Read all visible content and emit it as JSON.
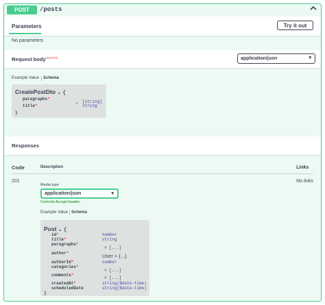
{
  "operation": {
    "method": "POST",
    "path": "/posts"
  },
  "parameters": {
    "tab": "Parameters",
    "try_button": "Try it out",
    "empty": "No parameters"
  },
  "request_body": {
    "title": "Request body",
    "required": "required",
    "content_type": "application/json",
    "tab_example": "Example Value",
    "tab_schema": "Schema",
    "model": {
      "name": "CreatePostDto",
      "open": "{",
      "close": "}",
      "props": [
        {
          "name": "paragraphs",
          "type": "[string]",
          "expand": "⌄"
        },
        {
          "name": "title",
          "type": "string"
        }
      ]
    }
  },
  "responses": {
    "title": "Responses",
    "col_code": "Code",
    "col_desc": "Description",
    "col_links": "Links",
    "row": {
      "code": "201",
      "links": "No links",
      "media_type_label": "Media type",
      "media_type": "application/json",
      "controls": "Controls Accept header.",
      "tab_example": "Example Value",
      "tab_schema": "Schema",
      "model": {
        "name": "Post",
        "open": "{",
        "close": "}",
        "props": [
          {
            "name": "id",
            "type": "number"
          },
          {
            "name": "title",
            "type": "string"
          },
          {
            "name": "paragraphs",
            "type": "> [...]"
          },
          {
            "name": "author",
            "type": "User > {...}"
          },
          {
            "name": "authorId",
            "type": "number"
          },
          {
            "name": "categories",
            "type": "> [...]"
          },
          {
            "name": "comments",
            "type": "> [...]"
          },
          {
            "name": "createdAt",
            "type": "string($date-time)"
          },
          {
            "name": "scheduledDate",
            "type": "string($date-time)"
          }
        ]
      }
    }
  },
  "colors": {
    "post_green": "#49cc90",
    "bg": "#edfaf4",
    "model_bg": "#dde2e0",
    "type_purple": "#4b48a6"
  }
}
